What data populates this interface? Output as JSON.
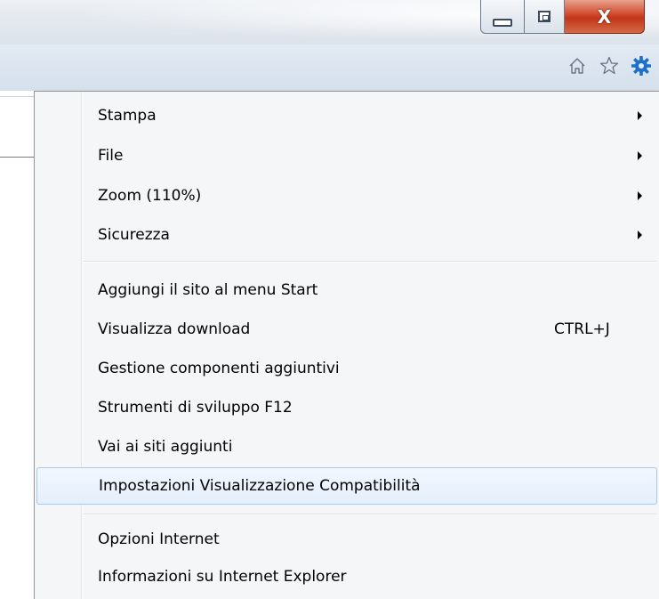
{
  "window": {
    "buttons": {
      "minimize_icon": "minimize-icon",
      "maximize_icon": "restore-icon",
      "close_icon": "close-icon",
      "close_glyph": "X"
    }
  },
  "toolbar": {
    "icons": [
      "home-icon",
      "favorites-star-icon",
      "tools-gear-icon"
    ],
    "accent": "#1e6fc8"
  },
  "menu": {
    "groups": [
      [
        {
          "label": "Stampa",
          "submenu": true
        },
        {
          "label": "File",
          "submenu": true
        },
        {
          "label": "Zoom (110%)",
          "submenu": true
        },
        {
          "label": "Sicurezza",
          "submenu": true
        }
      ],
      [
        {
          "label": "Aggiungi il sito al menu Start"
        },
        {
          "label": "Visualizza download",
          "shortcut": "CTRL+J"
        },
        {
          "label": "Gestione componenti aggiuntivi"
        },
        {
          "label": "Strumenti di sviluppo F12"
        },
        {
          "label": "Vai ai siti aggiunti"
        },
        {
          "label": "Impostazioni Visualizzazione Compatibilità",
          "highlighted": true
        }
      ],
      [
        {
          "label": "Opzioni Internet"
        },
        {
          "label": "Informazioni su Internet Explorer"
        }
      ]
    ],
    "highlight_color": "#a8c8ee"
  }
}
